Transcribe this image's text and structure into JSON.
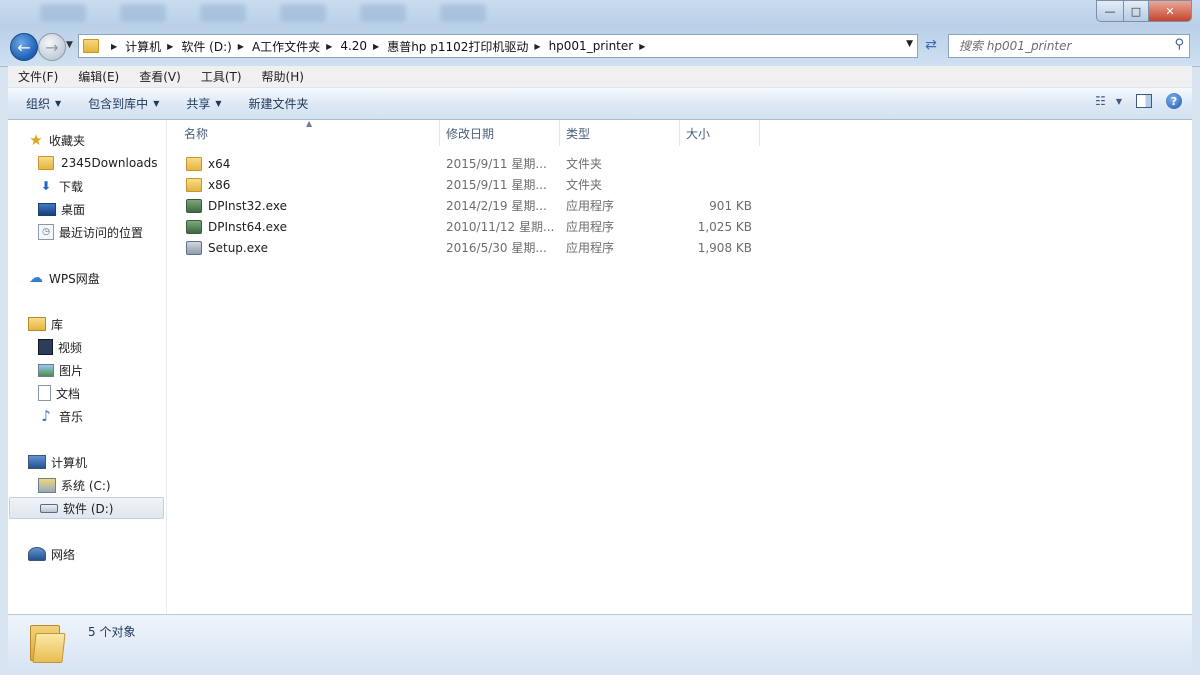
{
  "window": {
    "controls": {
      "minimize": "—",
      "maximize": "□",
      "close": "✕"
    }
  },
  "addressbar": {
    "crumbs": [
      "计算机",
      "软件 (D:)",
      "A工作文件夹",
      "4.20",
      "惠普hp p1102打印机驱动",
      "hp001_printer"
    ],
    "search_placeholder": "搜索 hp001_printer"
  },
  "menu": [
    "文件(F)",
    "编辑(E)",
    "查看(V)",
    "工具(T)",
    "帮助(H)"
  ],
  "toolbar": {
    "organize": "组织",
    "include_library": "包含到库中",
    "share": "共享",
    "new_folder": "新建文件夹"
  },
  "sidebar": {
    "favorites": "收藏夹",
    "fav_items": [
      "2345Downloads",
      "下载",
      "桌面",
      "最近访问的位置"
    ],
    "wps": "WPS网盘",
    "library": "库",
    "lib_items": [
      "视频",
      "图片",
      "文档",
      "音乐"
    ],
    "computer": "计算机",
    "computer_items": [
      "系统 (C:)",
      "软件 (D:)"
    ],
    "network": "网络"
  },
  "columns": [
    "名称",
    "修改日期",
    "类型",
    "大小"
  ],
  "files": [
    {
      "name": "x64",
      "date": "2015/9/11 星期...",
      "type": "文件夹",
      "size": "",
      "icon": "folder-icon"
    },
    {
      "name": "x86",
      "date": "2015/9/11 星期...",
      "type": "文件夹",
      "size": "",
      "icon": "folder-icon"
    },
    {
      "name": "DPInst32.exe",
      "date": "2014/2/19 星期...",
      "type": "应用程序",
      "size": "901 KB",
      "icon": "exe-icon"
    },
    {
      "name": "DPInst64.exe",
      "date": "2010/11/12 星期...",
      "type": "应用程序",
      "size": "1,025 KB",
      "icon": "exe-icon"
    },
    {
      "name": "Setup.exe",
      "date": "2016/5/30 星期...",
      "type": "应用程序",
      "size": "1,908 KB",
      "icon": "setup-exe-icon"
    }
  ],
  "status": {
    "count": "5 个对象"
  },
  "colors": {
    "accent": "#1e395b",
    "toolbar_bg": "#dde8f5",
    "selection": "#e0e6ef"
  }
}
